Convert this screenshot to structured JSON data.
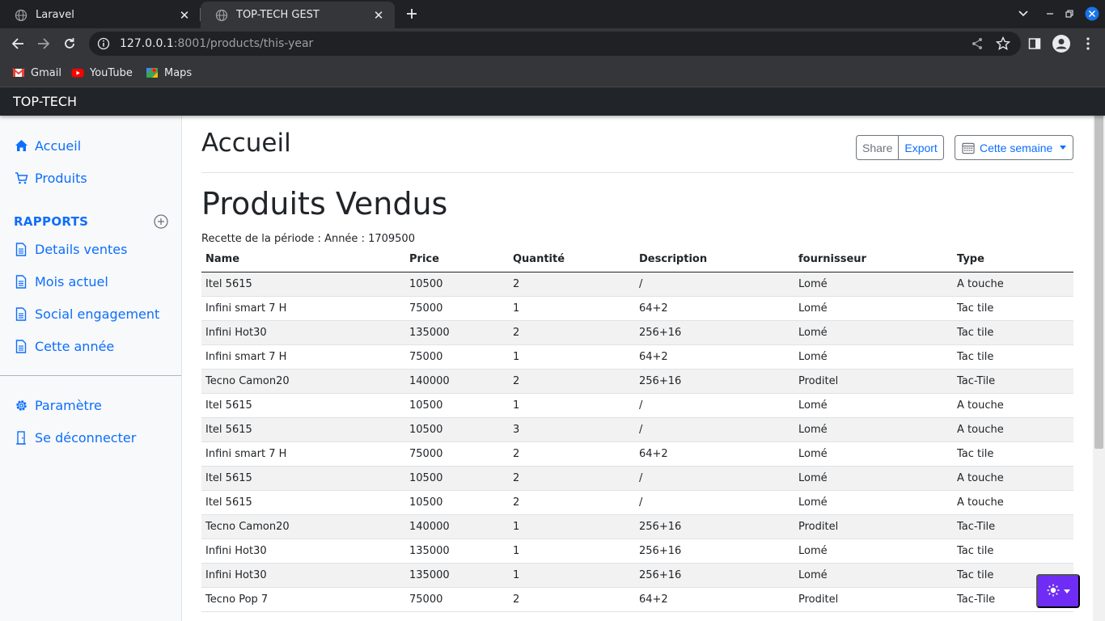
{
  "browser": {
    "tabs": [
      {
        "title": "Laravel",
        "active": false
      },
      {
        "title": "TOP-TECH GEST",
        "active": true
      }
    ],
    "url_host": "127.0.0.1",
    "url_path": ":8001/products/this-year",
    "bookmarks": [
      {
        "label": "Gmail",
        "icon": "gmail-icon"
      },
      {
        "label": "YouTube",
        "icon": "youtube-icon"
      },
      {
        "label": "Maps",
        "icon": "maps-icon"
      }
    ]
  },
  "navbar": {
    "brand": "TOP-TECH"
  },
  "sidebar": {
    "items": [
      {
        "label": "Accueil",
        "icon": "home-icon"
      },
      {
        "label": "Produits",
        "icon": "cart-icon"
      }
    ],
    "reports_heading": "RAPPORTS",
    "reports": [
      {
        "label": "Details ventes",
        "icon": "file-icon"
      },
      {
        "label": "Mois actuel",
        "icon": "file-icon"
      },
      {
        "label": "Social engagement",
        "icon": "file-icon"
      },
      {
        "label": "Cette année",
        "icon": "file-icon"
      }
    ],
    "bottom": [
      {
        "label": "Paramètre",
        "icon": "gear-icon"
      },
      {
        "label": "Se déconnecter",
        "icon": "door-icon"
      }
    ]
  },
  "main": {
    "page_title": "Accueil",
    "share_label": "Share",
    "export_label": "Export",
    "period_label": "Cette semaine",
    "section_title": "Produits Vendus",
    "recette": "Recette de la période : Année : 1709500",
    "columns": [
      "Name",
      "Price",
      "Quantité",
      "Description",
      "fournisseur",
      "Type"
    ],
    "rows": [
      [
        "Itel 5615",
        "10500",
        "2",
        "/",
        "Lomé",
        "A touche"
      ],
      [
        "Infini smart 7 H",
        "75000",
        "1",
        "64+2",
        "Lomé",
        "Tac tile"
      ],
      [
        "Infini Hot30",
        "135000",
        "2",
        "256+16",
        "Lomé",
        "Tac tile"
      ],
      [
        "Infini smart 7 H",
        "75000",
        "1",
        "64+2",
        "Lomé",
        "Tac tile"
      ],
      [
        "Tecno Camon20",
        "140000",
        "2",
        "256+16",
        "Proditel",
        "Tac-Tile"
      ],
      [
        "Itel 5615",
        "10500",
        "1",
        "/",
        "Lomé",
        "A touche"
      ],
      [
        "Itel 5615",
        "10500",
        "3",
        "/",
        "Lomé",
        "A touche"
      ],
      [
        "Infini smart 7 H",
        "75000",
        "2",
        "64+2",
        "Lomé",
        "Tac tile"
      ],
      [
        "Itel 5615",
        "10500",
        "2",
        "/",
        "Lomé",
        "A touche"
      ],
      [
        "Itel 5615",
        "10500",
        "2",
        "/",
        "Lomé",
        "A touche"
      ],
      [
        "Tecno Camon20",
        "140000",
        "1",
        "256+16",
        "Proditel",
        "Tac-Tile"
      ],
      [
        "Infini Hot30",
        "135000",
        "1",
        "256+16",
        "Lomé",
        "Tac tile"
      ],
      [
        "Infini Hot30",
        "135000",
        "1",
        "256+16",
        "Lomé",
        "Tac tile"
      ],
      [
        "Tecno Pop 7",
        "75000",
        "2",
        "64+2",
        "Proditel",
        "Tac-Tile"
      ]
    ]
  },
  "theme_toggle": {
    "icon": "sun-icon",
    "color": "#6f2cf5"
  },
  "colors": {
    "link": "#0d6efd",
    "navbar": "#212529",
    "browser_dark": "#202124",
    "browser_toolbar": "#35363a"
  }
}
